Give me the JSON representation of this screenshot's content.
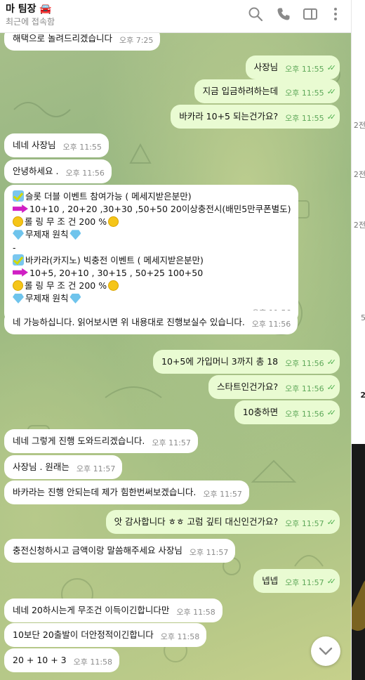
{
  "header": {
    "title": "마 팀장",
    "title_emoji": "🚘",
    "status": "최근에 접속함",
    "icons": [
      "search-icon",
      "phone-icon",
      "sidebar-toggle-icon",
      "more-vert-icon"
    ]
  },
  "messages": [
    {
      "dir": "in",
      "text": "해택으로 놀려드리겠습니다",
      "time": "오후 7:25"
    },
    {
      "dir": "out",
      "text": "사장님",
      "time": "오후 11:55"
    },
    {
      "dir": "out",
      "text": "지금 입금하려하는데",
      "time": "오후 11:55"
    },
    {
      "dir": "out",
      "text": "바카라 10+5 되는건가요?",
      "time": "오후 11:55"
    },
    {
      "dir": "in",
      "text": "네네 사장님",
      "time": "오후 11:55"
    },
    {
      "dir": "in",
      "text": "안녕하세요 .",
      "time": "오후 11:56"
    },
    {
      "dir": "in",
      "time": "오후 11:56",
      "lines": [
        "슬롯 더블 이벤트 참여가능 ( 메세지받은분만)",
        "10+10 , 20+20 ,30+30 ,50+50    20이상충전시(배민5만쿠폰별도)",
        "롤 링  무 조 건 200 %",
        "무제재 원칙",
        "-",
        "바카라(카지노) 빅충전 이벤트 ( 메세지받은분만)",
        "10+5,  20+10 , 30+15 , 50+25 100+50",
        "롤 링  무 조 건 200 %",
        "무제재 원칙"
      ]
    },
    {
      "dir": "in",
      "text": "네 가능하십니다. 읽어보시면 위 내용대로 진행보실수 있습니다.",
      "time": "오후 11:56"
    },
    {
      "dir": "out",
      "text": "10+5에 가입머니 3까지 총 18",
      "time": "오후 11:56"
    },
    {
      "dir": "out",
      "text": "스타트인건가요?",
      "time": "오후 11:56"
    },
    {
      "dir": "out",
      "text": "10충하면",
      "time": "오후 11:56"
    },
    {
      "dir": "in",
      "text": "네네 그렇게 진행 도와드리겠습니다.",
      "time": "오후 11:57"
    },
    {
      "dir": "in",
      "text": "사장님 . 원래는",
      "time": "오후 11:57"
    },
    {
      "dir": "in",
      "text": "바카라는 진행 안되는데 제가 힘한번써보겠습니다.",
      "time": "오후 11:57"
    },
    {
      "dir": "out",
      "text": "앗 감사합니다 ㅎㅎ 고럼 깊티 대신인건가요?",
      "time": "오후 11:57"
    },
    {
      "dir": "in",
      "text": "충전신청하시고 금액이랑 말씀해주세요 사장님",
      "time": "오후 11:57"
    },
    {
      "dir": "out",
      "text": "넵넵",
      "time": "오후 11:57"
    },
    {
      "dir": "in",
      "text": "네네 20하시는게 무조건 이득이긴합니다만",
      "time": "오후 11:58"
    },
    {
      "dir": "in",
      "text": "10보단 20출발이 더안정적이긴합니다",
      "time": "오후 11:58"
    },
    {
      "dir": "in",
      "text": "20 + 10 + 3",
      "time": "오후 11:58"
    }
  ],
  "right_panel_fragments": [
    "2전",
    "2전",
    "2전",
    "5",
    "2"
  ],
  "scroll_down_icon": "chevron-down-icon",
  "colors": {
    "incoming": "#ffffff",
    "outgoing": "#e9fbd2",
    "read_check": "#4fb04e"
  }
}
